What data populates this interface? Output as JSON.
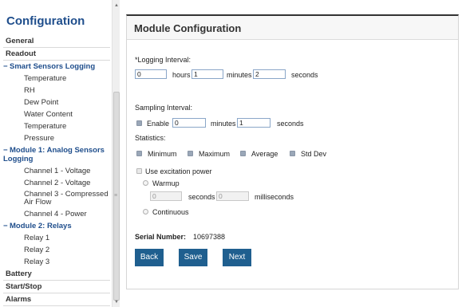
{
  "sidebar": {
    "title": "Configuration",
    "items": [
      {
        "label": "General",
        "kind": "top"
      },
      {
        "label": "Readout",
        "kind": "top"
      },
      {
        "label": "Smart Sensors Logging",
        "kind": "group"
      },
      {
        "label": "Temperature",
        "kind": "sub"
      },
      {
        "label": "RH",
        "kind": "sub"
      },
      {
        "label": "Dew Point",
        "kind": "sub"
      },
      {
        "label": "Water Content",
        "kind": "sub"
      },
      {
        "label": "Temperature",
        "kind": "sub"
      },
      {
        "label": "Pressure",
        "kind": "sub"
      },
      {
        "label": "Module 1: Analog Sensors Logging",
        "kind": "group"
      },
      {
        "label": "Channel 1 - Voltage",
        "kind": "sub"
      },
      {
        "label": "Channel 2 - Voltage",
        "kind": "sub"
      },
      {
        "label": "Channel 3 - Compressed Air Flow",
        "kind": "sub"
      },
      {
        "label": "Channel 4 - Power",
        "kind": "sub"
      },
      {
        "label": "Module 2: Relays",
        "kind": "group"
      },
      {
        "label": "Relay 1",
        "kind": "sub"
      },
      {
        "label": "Relay 2",
        "kind": "sub"
      },
      {
        "label": "Relay 3",
        "kind": "sub"
      },
      {
        "label": "Battery",
        "kind": "top"
      },
      {
        "label": "Start/Stop",
        "kind": "top"
      },
      {
        "label": "Alarms",
        "kind": "top"
      }
    ]
  },
  "panel": {
    "title": "Module Configuration",
    "logging": {
      "label": "*Logging Interval:",
      "hours_value": "0",
      "hours_label": "hours",
      "minutes_value": "1",
      "minutes_label": "minutes",
      "seconds_value": "2",
      "seconds_label": "seconds"
    },
    "sampling": {
      "label": "Sampling Interval:",
      "enable_label": "Enable",
      "minutes_value": "0",
      "minutes_label": "minutes",
      "seconds_value": "1",
      "seconds_label": "seconds"
    },
    "statistics": {
      "label": "Statistics:",
      "options": [
        "Minimum",
        "Maximum",
        "Average",
        "Std Dev"
      ]
    },
    "excitation": {
      "label": "Use excitation power",
      "warmup_label": "Warmup",
      "seconds_value": "0",
      "seconds_label": "seconds",
      "milliseconds_value": "0",
      "milliseconds_label": "milliseconds",
      "continuous_label": "Continuous"
    },
    "serial": {
      "label": "Serial Number:",
      "value": "10697388"
    },
    "buttons": {
      "back": "Back",
      "save": "Save",
      "next": "Next"
    }
  },
  "colors": {
    "accent": "#1f5f8f",
    "nav_heading": "#1f4e8c"
  }
}
